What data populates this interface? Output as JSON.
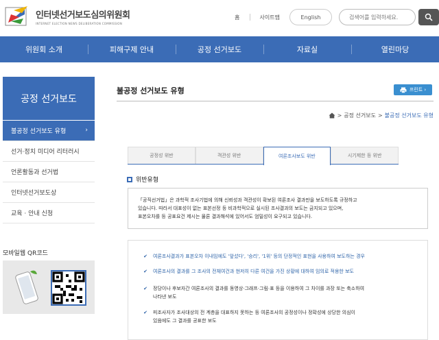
{
  "header": {
    "logo_title": "인터넷선거보도심의위원회",
    "logo_sub": "INTERNET ELECTION NEWS DELIBERATION COMMISSION",
    "home": "홈",
    "sitemap": "사이트맵",
    "english": "English",
    "search_placeholder": "검색어를 입력하세요."
  },
  "gnb": [
    "위원회 소개",
    "피해구제 안내",
    "공정 선거보도",
    "자료실",
    "열린마당"
  ],
  "lnb": {
    "title": "공정 선거보도",
    "items": [
      "불공정 선거보도 유형",
      "선거·정치 미디어 리터러시",
      "언론활동과 선거법",
      "인터넷선거보도상",
      "교육 · 안내 신청"
    ],
    "active_arrow": "›"
  },
  "qr": {
    "title": "모바일웹 QR코드"
  },
  "main": {
    "title": "불공정 선거보도 유형",
    "print": "프린트 ›",
    "breadcrumb": [
      "공정 선거보도",
      "불공정 선거보도 유형"
    ],
    "tabs": [
      "공정성 위반",
      "객관성 위반",
      "여론조사보도 위반",
      "시기제한 등 위반"
    ],
    "section": "위반유형",
    "intro": [
      "「공직선거법」은 과학적 조사기법에 의해 신뢰성과 객관성이 확보된 여론조사 결과만을 보도하도록 규정하고",
      "있습니다. 따라서 대표성이 없는 표본선정 등 비과학적으로 실시된 조사결과의 보도는 금지되고 있으며,",
      "표본오차를 등 공표요건 제시는 물론 결과해석에 있어서도 엄밀성이 요구되고 있습니다."
    ],
    "list": [
      [
        "여론조사결과가 표본오차 이내임에도 '앞섰다', '승리', '1위' 등의 단정적인 표현을 사용하여 보도하는 경우"
      ],
      [
        "여론조사의 결과를 그 조사의 전체여건과 현저히 다른 여건을 가진 상황에 대하여 임의로 적용한 보도"
      ],
      [
        "정당이나 후보자간 여론조사의 결과를 동영상·그래프·그림·표 등을 이용하여 그 차이를 과장 또는 축소하여",
        "나타낸 보도"
      ],
      [
        "피조사자가 조사대상의 전 계층을 대표하지 못하는 등 여론조사의 공정성이나 정확성에 상당한 의심이",
        "있음에도 그 결과를 공표한 보도"
      ]
    ]
  },
  "colors": {
    "primary": "#3b6cb6",
    "print": "#3a8fd0"
  }
}
